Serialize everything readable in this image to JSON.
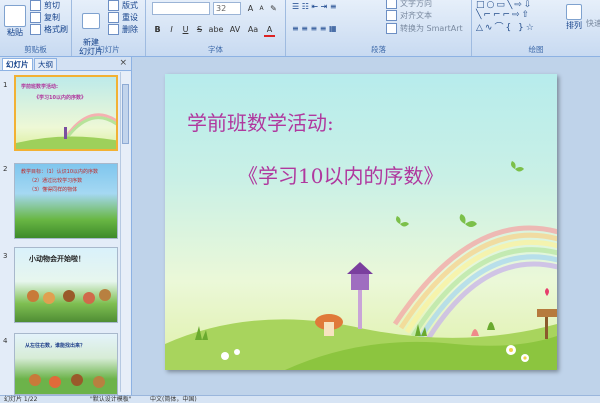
{
  "ribbon": {
    "clipboard": {
      "paste": "粘贴",
      "cut": "剪切",
      "copy": "复制",
      "format_painter": "格式刷",
      "label": "剪贴板"
    },
    "slides": {
      "new_slide": "新建\n幻灯片",
      "layout": "版式",
      "reset": "重设",
      "delete": "删除",
      "label": "幻灯片"
    },
    "font": {
      "font_name": "",
      "font_size": "32",
      "bold": "B",
      "italic": "I",
      "underline": "U",
      "strike": "S",
      "shadow": "abe",
      "spacing": "AV",
      "case": "Aa",
      "color": "A",
      "label": "字体"
    },
    "paragraph": {
      "text_direction": "文字方向",
      "align_text": "对齐文本",
      "smartart": "转换为 SmartArt",
      "label": "段落"
    },
    "drawing": {
      "arrange": "排列",
      "quick_styles": "快速",
      "label": "绘图"
    }
  },
  "panel": {
    "tab_slides": "幻灯片",
    "tab_outline": "大纲",
    "close": "×"
  },
  "thumbnails": [
    {
      "num": "1",
      "title": "学前班数学活动:",
      "subtitle": "《学习10以内的序数》"
    },
    {
      "num": "2",
      "lines": [
        "教学目标：（1）认识10以内的序数",
        "（2）通过比较学习序数",
        "（3）懂得同样的物体"
      ]
    },
    {
      "num": "3",
      "title": "小动物会开始啦！"
    },
    {
      "num": "4",
      "title": "从左往右数，谁能找出来？"
    }
  ],
  "slide": {
    "title": "学前班数学活动:",
    "subtitle": "《学习10以内的序数》"
  },
  "status": {
    "slide_count": "幻灯片 1/22",
    "theme": "\"默认设计模板\"",
    "language": "中文(简体，中国)"
  },
  "colors": {
    "title_text": "#b0389e",
    "ribbon_bg": "#dbe8f7",
    "selection": "#f2b134"
  }
}
